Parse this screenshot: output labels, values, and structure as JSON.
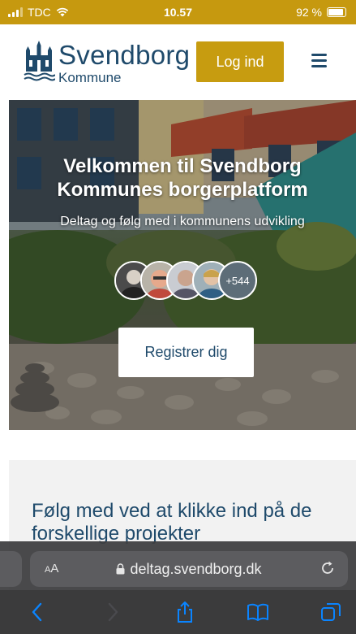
{
  "status_bar": {
    "carrier": "TDC",
    "time": "10.57",
    "battery_percent": "92 %",
    "battery_level": 0.92
  },
  "header": {
    "logo_name": "Svendborg",
    "logo_sub": "Kommune",
    "login_label": "Log ind",
    "menu_icon": "hamburger-icon"
  },
  "hero": {
    "title": "Velkommen til Svendborg Kommunes borgerplatform",
    "subtitle": "Deltag og følg med i kommunens udvikling",
    "participants_more": "+544",
    "register_label": "Registrer dig"
  },
  "follow": {
    "title": "Følg med ved at klikke ind på de forskellige projekter"
  },
  "browser": {
    "text_size_label": "AA",
    "url": "deltag.svendborg.dk",
    "lock_icon": "lock-icon",
    "reload_icon": "reload-icon",
    "toolbar_icons": [
      "back-icon",
      "forward-icon",
      "share-icon",
      "bookmarks-icon",
      "tabs-icon"
    ]
  },
  "colors": {
    "status_bar": "#c6990f",
    "brand_gold": "#c79c10",
    "brand_blue": "#1f4a6b",
    "ios_blue": "#0a84ff"
  }
}
